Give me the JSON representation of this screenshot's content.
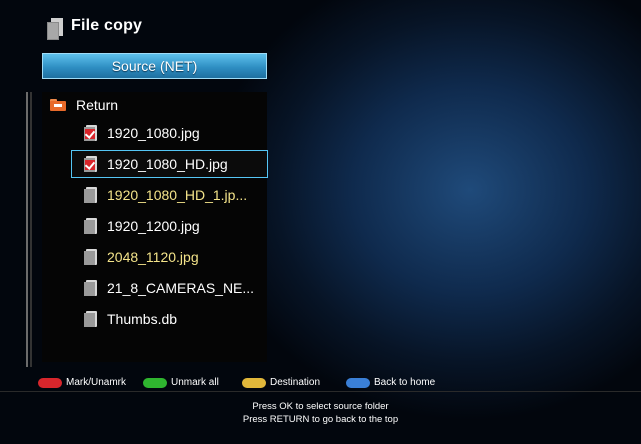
{
  "header": {
    "title": "File copy",
    "icon": "file-icon"
  },
  "source": {
    "label": "Source (NET)",
    "color": "#3aa6dc"
  },
  "list": {
    "return_label": "Return",
    "items": [
      {
        "name": "1920_1080.jpg",
        "marked": true,
        "focused": false,
        "color": "#ffffff"
      },
      {
        "name": "1920_1080_HD.jpg",
        "marked": true,
        "focused": true,
        "color": "#ffffff"
      },
      {
        "name": "1920_1080_HD_1.jp...",
        "marked": false,
        "focused": false,
        "color": "#f4e48a"
      },
      {
        "name": "1920_1200.jpg",
        "marked": false,
        "focused": false,
        "color": "#ffffff"
      },
      {
        "name": "2048_1120.jpg",
        "marked": false,
        "focused": false,
        "color": "#f4e48a"
      },
      {
        "name": "21_8_CAMERAS_NE...",
        "marked": false,
        "focused": false,
        "color": "#ffffff"
      },
      {
        "name": "Thumbs.db",
        "marked": false,
        "focused": false,
        "color": "#ffffff"
      }
    ]
  },
  "legend": [
    {
      "label": "Mark/Unamrk",
      "color": "#d8262c"
    },
    {
      "label": "Unmark all",
      "color": "#2fb52f"
    },
    {
      "label": "Destination",
      "color": "#e1b73a"
    },
    {
      "label": "Back to home",
      "color": "#3a7fd6"
    }
  ],
  "footer": {
    "line1": "Press OK to select source folder",
    "line2": "Press RETURN to go back to the top"
  }
}
